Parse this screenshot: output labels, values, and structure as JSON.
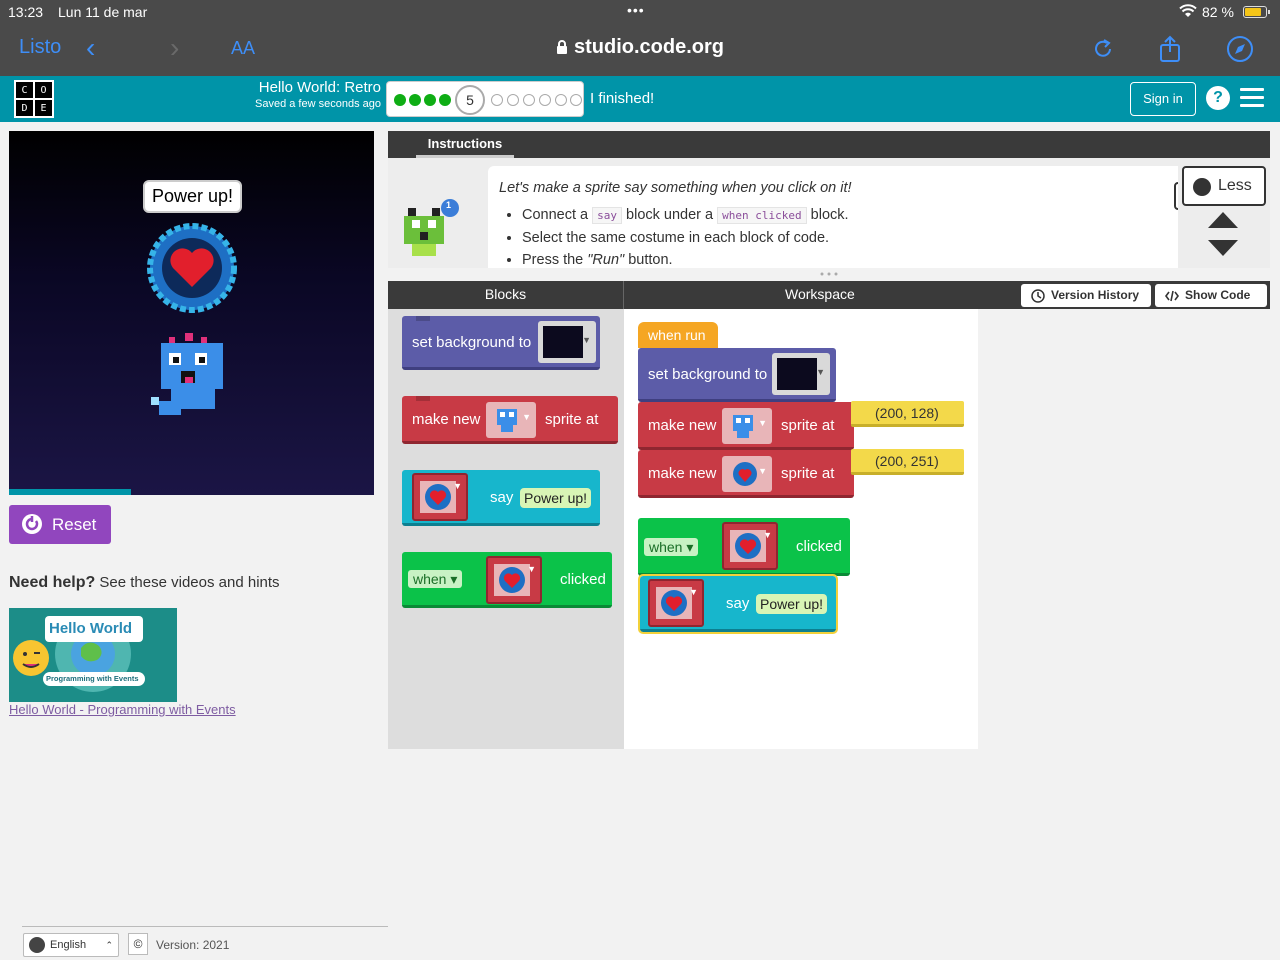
{
  "status_bar": {
    "time": "13:23",
    "date": "Lun 11 de mar",
    "dots": "•••",
    "battery": "82 %",
    "battery_level": 0.82
  },
  "browser": {
    "done_label": "Listo",
    "aa_label": "AA",
    "url": "studio.code.org",
    "icons": [
      "chevron-left-icon",
      "chevron-right-icon",
      "reload-icon",
      "share-icon",
      "compass-icon"
    ]
  },
  "header": {
    "logo_letters": [
      "C",
      "O",
      "D",
      "E"
    ],
    "project_title": "Hello World: Retro",
    "saved_text": "Saved a few seconds ago",
    "progress": {
      "completed": 4,
      "current_level": "5",
      "remaining": 6
    },
    "finished_label": "I finished!",
    "sign_in_label": "Sign in",
    "help_label": "?",
    "accent_color": "#0094a8"
  },
  "game": {
    "speech": "Power up!",
    "reset_label": "Reset"
  },
  "help": {
    "title": "Need help?",
    "subtitle": "See these videos and hints",
    "video_title": "Hello World",
    "video_caption": "Programming with Events",
    "video_link": "Hello World - Programming with Events"
  },
  "instructions": {
    "tab_label": "Instructions",
    "lead": "Let's make a sprite say something when you click on it!",
    "steps": {
      "s1_a": "Connect a",
      "s1_code1": "say",
      "s1_b": "block under a",
      "s1_code2": "when clicked",
      "s1_c": "block.",
      "s2": "Select the same costume in each block of code.",
      "s3_a": "Press the",
      "s3_run": "\"Run\"",
      "s3_b": "button."
    },
    "less_label": "Less",
    "badge_count": "1"
  },
  "workspace": {
    "blocks_title": "Blocks",
    "workspace_title": "Workspace",
    "version_history_label": "Version History",
    "show_code_label": "Show Code"
  },
  "toolbox_blocks": {
    "set_background": "set background to",
    "make_new": "make new",
    "sprite_at": "sprite at",
    "say": "say",
    "say_text": "Power up!",
    "when": "when",
    "clicked": "clicked"
  },
  "workspace_blocks": {
    "when_run": "when run",
    "set_background": "set background to",
    "make_new_1": "make new",
    "sprite_at_1": "sprite at",
    "coord_1": "(200, 128)",
    "make_new_2": "make new",
    "sprite_at_2": "sprite at",
    "coord_2": "(200, 251)",
    "when": "when",
    "clicked": "clicked",
    "say": "say",
    "say_text": "Power up!"
  },
  "footer": {
    "language": "English",
    "copyright": "©",
    "version": "Version: 2021"
  }
}
